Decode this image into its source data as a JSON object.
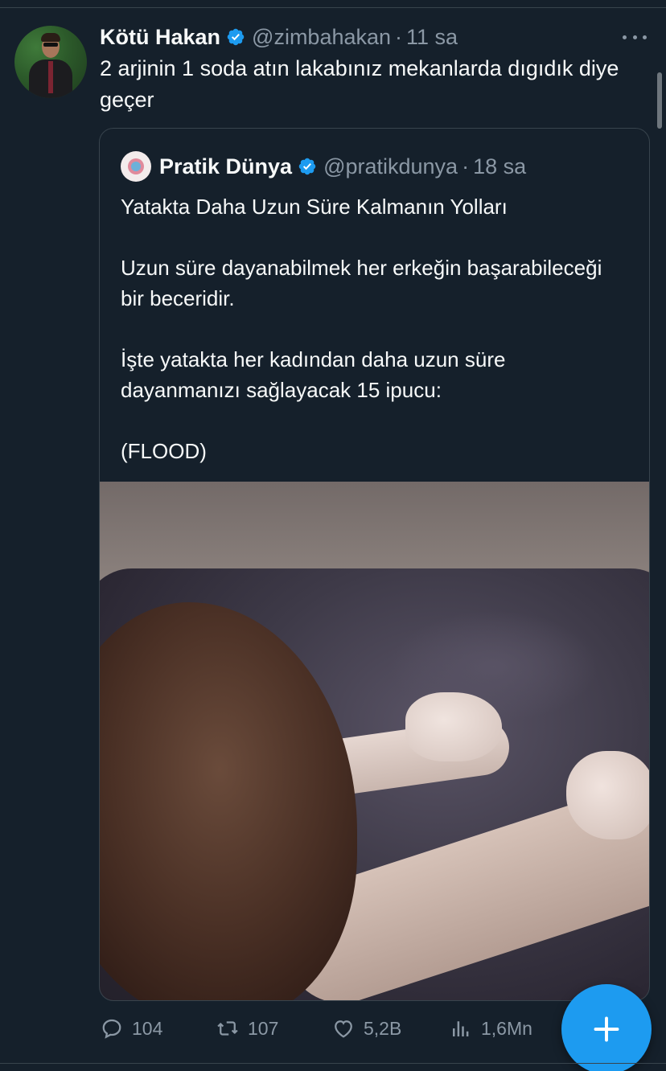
{
  "tweet": {
    "author_name": "Kötü Hakan",
    "handle": "@zimbahakan",
    "time": "11 sa",
    "text": "2 arjinin 1 soda atın lakabınız mekanlarda dıgıdık diye geçer"
  },
  "quote": {
    "author_name": "Pratik Dünya",
    "handle": "@pratikdunya",
    "time": "18 sa",
    "paragraphs": [
      "Yatakta Daha Uzun Süre Kalmanın Yolları",
      "Uzun süre dayanabilmek her erkeğin başarabileceği bir beceridir.",
      "İşte yatakta her kadından daha uzun süre dayanmanızı sağlayacak 15 ipucu:",
      "(FLOOD)"
    ]
  },
  "actions": {
    "replies": "104",
    "retweets": "107",
    "likes": "5,2B",
    "views": "1,6Mn"
  },
  "icons": {
    "verified": "verified-badge-icon",
    "more": "more-options-icon",
    "reply": "reply-icon",
    "retweet": "retweet-icon",
    "like": "heart-icon",
    "views": "analytics-icon",
    "compose": "plus-icon"
  },
  "colors": {
    "background": "#15202b",
    "border": "#38444d",
    "text": "#f7f9f9",
    "secondary_text": "#8b98a5",
    "accent": "#1d9bf0"
  }
}
